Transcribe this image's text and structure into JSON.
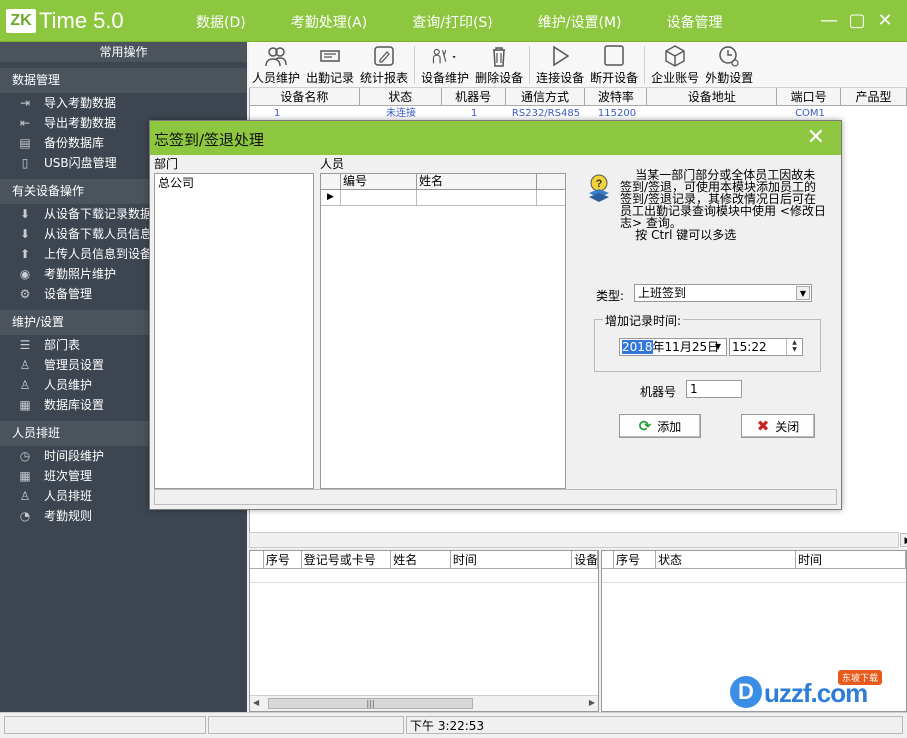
{
  "app": {
    "logo_zk": "ZK",
    "logo_time": "Time",
    "logo_version": "5.0",
    "menu": [
      "数据(D)",
      "考勤处理(A)",
      "查询/打印(S)",
      "维护/设置(M)",
      "设备管理"
    ],
    "window_controls": [
      "—",
      "▢",
      "✕"
    ],
    "brand_color": "#8dc63f",
    "sidebar_color": "#3d4550"
  },
  "sidebar": {
    "top_header": "常用操作",
    "sections": [
      {
        "title": "数据管理",
        "items": [
          "导入考勤数据",
          "导出考勤数据",
          "备份数据库",
          "USB闪盘管理"
        ]
      },
      {
        "title": "有关设备操作",
        "items": [
          "从设备下载记录数据",
          "从设备下载人员信息",
          "上传人员信息到设备",
          "考勤照片维护",
          "设备管理"
        ]
      },
      {
        "title": "维护/设置",
        "items": [
          "部门表",
          "管理员设置",
          "人员维护",
          "数据库设置"
        ]
      },
      {
        "title": "人员排班",
        "items": [
          "时间段维护",
          "班次管理",
          "人员排班",
          "考勤规则"
        ]
      }
    ]
  },
  "toolbar": {
    "buttons": [
      "人员维护",
      "出勤记录",
      "统计报表",
      "设备维护",
      "删除设备",
      "连接设备",
      "断开设备",
      "企业账号",
      "外勤设置"
    ]
  },
  "device_table": {
    "headers": [
      "设备名称",
      "状态",
      "机器号",
      "通信方式",
      "波特率",
      "设备地址",
      "端口号",
      "产品型"
    ],
    "row": [
      "1",
      "未连接",
      "1",
      "RS232/RS485",
      "115200",
      "",
      "COM1",
      ""
    ]
  },
  "record_table_left": {
    "headers": [
      "序号",
      "登记号或卡号",
      "姓名",
      "时间",
      "设备"
    ]
  },
  "record_table_right": {
    "headers": [
      "序号",
      "状态",
      "时间"
    ]
  },
  "status_bar": {
    "time": "下午 3:22:53"
  },
  "watermark": {
    "d": "D",
    "text": "uzzf.com",
    "badge": "东坡下载"
  },
  "dialog": {
    "title": "忘签到/签退处理",
    "dept_label": "部门",
    "dept_items": [
      "总公司"
    ],
    "emp_label": "人员",
    "emp_headers": [
      "编号",
      "姓名"
    ],
    "info_text": "    当某一部门部分或全体员工因故未\n签到/签退，可使用本模块添加员工的\n签到/签退记录，其修改情况日后可在\n员工出勤记录查询模块中使用 <修改日\n志> 查询。\n    按 Ctrl 键可以多选",
    "type_label": "类型:",
    "type_value": "上班签到",
    "time_group_label": "增加记录时间:",
    "date_year": "2018",
    "date_rest": "年11月25日",
    "time_value": "15:22",
    "machine_label": "机器号",
    "machine_value": "1",
    "add_button": "添加",
    "close_button": "关闭"
  }
}
